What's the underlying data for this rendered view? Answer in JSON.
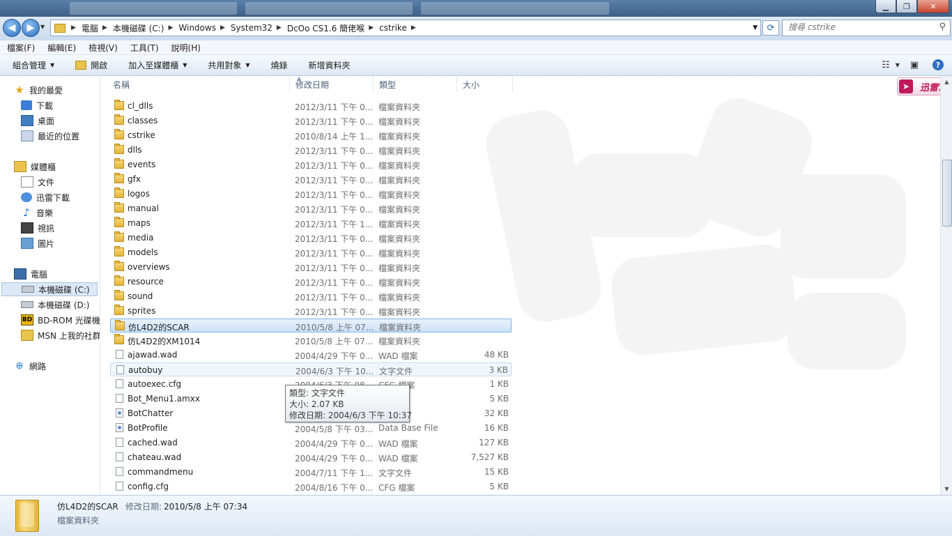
{
  "address": {
    "crumbs": [
      "電腦",
      "本機磁碟 (C:)",
      "Windows",
      "System32",
      "DcOo CS1.6 簡佬喉",
      "cstrike"
    ],
    "search_placeholder": "搜尋 cstrike"
  },
  "menu": [
    "檔案(F)",
    "編輯(E)",
    "檢視(V)",
    "工具(T)",
    "說明(H)"
  ],
  "toolbar": {
    "organize": "組合管理",
    "open": "開啟",
    "add_to_library": "加入至媒體櫃",
    "share": "共用對象",
    "burn": "燒錄",
    "new_folder": "新增資料夾"
  },
  "badge": {
    "label": "迅雷7"
  },
  "nav": {
    "favorites": "我的最愛",
    "downloads": "下載",
    "desktop": "桌面",
    "recent": "最近的位置",
    "libraries": "媒體櫃",
    "documents": "文件",
    "xunlei": "迅雷下載",
    "music": "音樂",
    "videos": "視訊",
    "pictures": "圖片",
    "computer": "電腦",
    "drive_c": "本機磁碟 (C:)",
    "drive_d": "本機磁碟 (D:)",
    "bd_rom": "BD-ROM 光碟機",
    "msn": "MSN 上我的社群",
    "network": "網路"
  },
  "columns": {
    "name": "名稱",
    "date": "修改日期",
    "type": "類型",
    "size": "大小"
  },
  "files": [
    {
      "name": "cl_dlls",
      "date": "2012/3/11 下午 0...",
      "type": "檔案資料夾",
      "size": "",
      "kind": "folder"
    },
    {
      "name": "classes",
      "date": "2012/3/11 下午 0...",
      "type": "檔案資料夾",
      "size": "",
      "kind": "folder"
    },
    {
      "name": "cstrike",
      "date": "2010/8/14 上午 1...",
      "type": "檔案資料夾",
      "size": "",
      "kind": "folder"
    },
    {
      "name": "dlls",
      "date": "2012/3/11 下午 0...",
      "type": "檔案資料夾",
      "size": "",
      "kind": "folder"
    },
    {
      "name": "events",
      "date": "2012/3/11 下午 0...",
      "type": "檔案資料夾",
      "size": "",
      "kind": "folder"
    },
    {
      "name": "gfx",
      "date": "2012/3/11 下午 0...",
      "type": "檔案資料夾",
      "size": "",
      "kind": "folder"
    },
    {
      "name": "logos",
      "date": "2012/3/11 下午 0...",
      "type": "檔案資料夾",
      "size": "",
      "kind": "folder"
    },
    {
      "name": "manual",
      "date": "2012/3/11 下午 0...",
      "type": "檔案資料夾",
      "size": "",
      "kind": "folder"
    },
    {
      "name": "maps",
      "date": "2012/3/11 下午 1...",
      "type": "檔案資料夾",
      "size": "",
      "kind": "folder"
    },
    {
      "name": "media",
      "date": "2012/3/11 下午 0...",
      "type": "檔案資料夾",
      "size": "",
      "kind": "folder"
    },
    {
      "name": "models",
      "date": "2012/3/11 下午 0...",
      "type": "檔案資料夾",
      "size": "",
      "kind": "folder"
    },
    {
      "name": "overviews",
      "date": "2012/3/11 下午 0...",
      "type": "檔案資料夾",
      "size": "",
      "kind": "folder"
    },
    {
      "name": "resource",
      "date": "2012/3/11 下午 0...",
      "type": "檔案資料夾",
      "size": "",
      "kind": "folder"
    },
    {
      "name": "sound",
      "date": "2012/3/11 下午 0...",
      "type": "檔案資料夾",
      "size": "",
      "kind": "folder"
    },
    {
      "name": "sprites",
      "date": "2012/3/11 下午 0...",
      "type": "檔案資料夾",
      "size": "",
      "kind": "folder"
    },
    {
      "name": "仿L4D2的SCAR",
      "date": "2010/5/8 上午 07...",
      "type": "檔案資料夾",
      "size": "",
      "kind": "folder",
      "state": "selected"
    },
    {
      "name": "仿L4D2的XM1014",
      "date": "2010/5/8 上午 07...",
      "type": "檔案資料夾",
      "size": "",
      "kind": "folder"
    },
    {
      "name": "ajawad.wad",
      "date": "2004/4/29 下午 0...",
      "type": "WAD 檔案",
      "size": "48 KB",
      "kind": "file"
    },
    {
      "name": "autobuy",
      "date": "2004/6/3 下午 10...",
      "type": "文字文件",
      "size": "3 KB",
      "kind": "file",
      "state": "hover"
    },
    {
      "name": "autoexec.cfg",
      "date": "2004/6/3 下午 08...",
      "type": "CFG 檔案",
      "size": "1 KB",
      "kind": "file"
    },
    {
      "name": "Bot_Menu1.amxx",
      "date": "",
      "type": "檔案",
      "size": "5 KB",
      "kind": "file"
    },
    {
      "name": "BotChatter",
      "date": "",
      "type": "se File",
      "size": "32 KB",
      "kind": "dbfile"
    },
    {
      "name": "BotProfile",
      "date": "2004/5/8 下午 03...",
      "type": "Data Base File",
      "size": "16 KB",
      "kind": "dbfile"
    },
    {
      "name": "cached.wad",
      "date": "2004/4/29 下午 0...",
      "type": "WAD 檔案",
      "size": "127 KB",
      "kind": "file"
    },
    {
      "name": "chateau.wad",
      "date": "2004/4/29 下午 0...",
      "type": "WAD 檔案",
      "size": "7,527 KB",
      "kind": "file"
    },
    {
      "name": "commandmenu",
      "date": "2004/7/11 下午 1...",
      "type": "文字文件",
      "size": "15 KB",
      "kind": "file"
    },
    {
      "name": "config.cfg",
      "date": "2004/8/16 下午 0...",
      "type": "CFG 檔案",
      "size": "5 KB",
      "kind": "file"
    }
  ],
  "tooltip": {
    "type_line": "類型: 文字文件",
    "size_line": "大小: 2.07 KB",
    "date_line": "修改日期: 2004/6/3 下午 10:37"
  },
  "details": {
    "name": "仿L4D2的SCAR",
    "modified_label": "修改日期:",
    "modified_value": "2010/5/8 上午 07:34",
    "type": "檔案資料夾"
  }
}
